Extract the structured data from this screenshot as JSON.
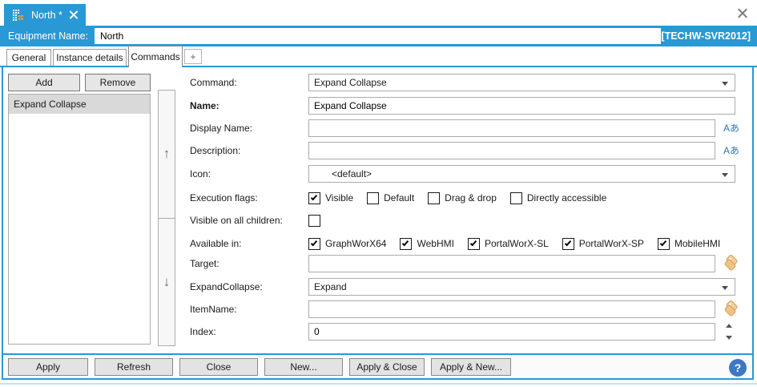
{
  "window_title_tab": {
    "title": "North *"
  },
  "equipment": {
    "label": "Equipment Name:",
    "value": "North",
    "server": "[TECHW-SVR2012]"
  },
  "tabs": [
    {
      "label": "General",
      "active": false
    },
    {
      "label": "Instance details",
      "active": false
    },
    {
      "label": "Commands",
      "active": true
    },
    {
      "label": "+",
      "add": true
    }
  ],
  "left_panel": {
    "add_label": "Add",
    "remove_label": "Remove",
    "items": [
      {
        "label": "Expand Collapse",
        "selected": true
      }
    ]
  },
  "form": {
    "command": {
      "label": "Command:",
      "value": "Expand Collapse"
    },
    "name": {
      "label": "Name:",
      "value": "Expand Collapse"
    },
    "display_name": {
      "label": "Display Name:",
      "value": ""
    },
    "description": {
      "label": "Description:",
      "value": ""
    },
    "icon": {
      "label": "Icon:",
      "value": "<default>"
    },
    "execution_flags": {
      "label": "Execution flags:",
      "options": [
        {
          "label": "Visible",
          "checked": true
        },
        {
          "label": "Default",
          "checked": false
        },
        {
          "label": "Drag & drop",
          "checked": false
        },
        {
          "label": "Directly accessible",
          "checked": false
        }
      ]
    },
    "visible_all_children": {
      "label": "Visible on all children:",
      "checked": false
    },
    "available_in": {
      "label": "Available in:",
      "options": [
        {
          "label": "GraphWorX64",
          "checked": true
        },
        {
          "label": "WebHMI",
          "checked": true
        },
        {
          "label": "PortalWorX-SL",
          "checked": true
        },
        {
          "label": "PortalWorX-SP",
          "checked": true
        },
        {
          "label": "MobileHMI",
          "checked": true
        }
      ]
    },
    "target": {
      "label": "Target:",
      "value": ""
    },
    "expand_collapse": {
      "label": "ExpandCollapse:",
      "value": "Expand"
    },
    "item_name": {
      "label": "ItemName:",
      "value": ""
    },
    "index": {
      "label": "Index:",
      "value": "0"
    }
  },
  "icons": {
    "up_arrow": "↑",
    "down_arrow": "↓",
    "localize": "Aあ",
    "help": "?"
  },
  "footer": {
    "buttons": [
      "Apply",
      "Refresh",
      "Close",
      "New...",
      "Apply & Close",
      "Apply & New..."
    ]
  },
  "colors": {
    "accent": "#2899D5",
    "selection": "#D9D9D9",
    "help_blue": "#3C78C3",
    "tag_tan": "#EFC285"
  }
}
